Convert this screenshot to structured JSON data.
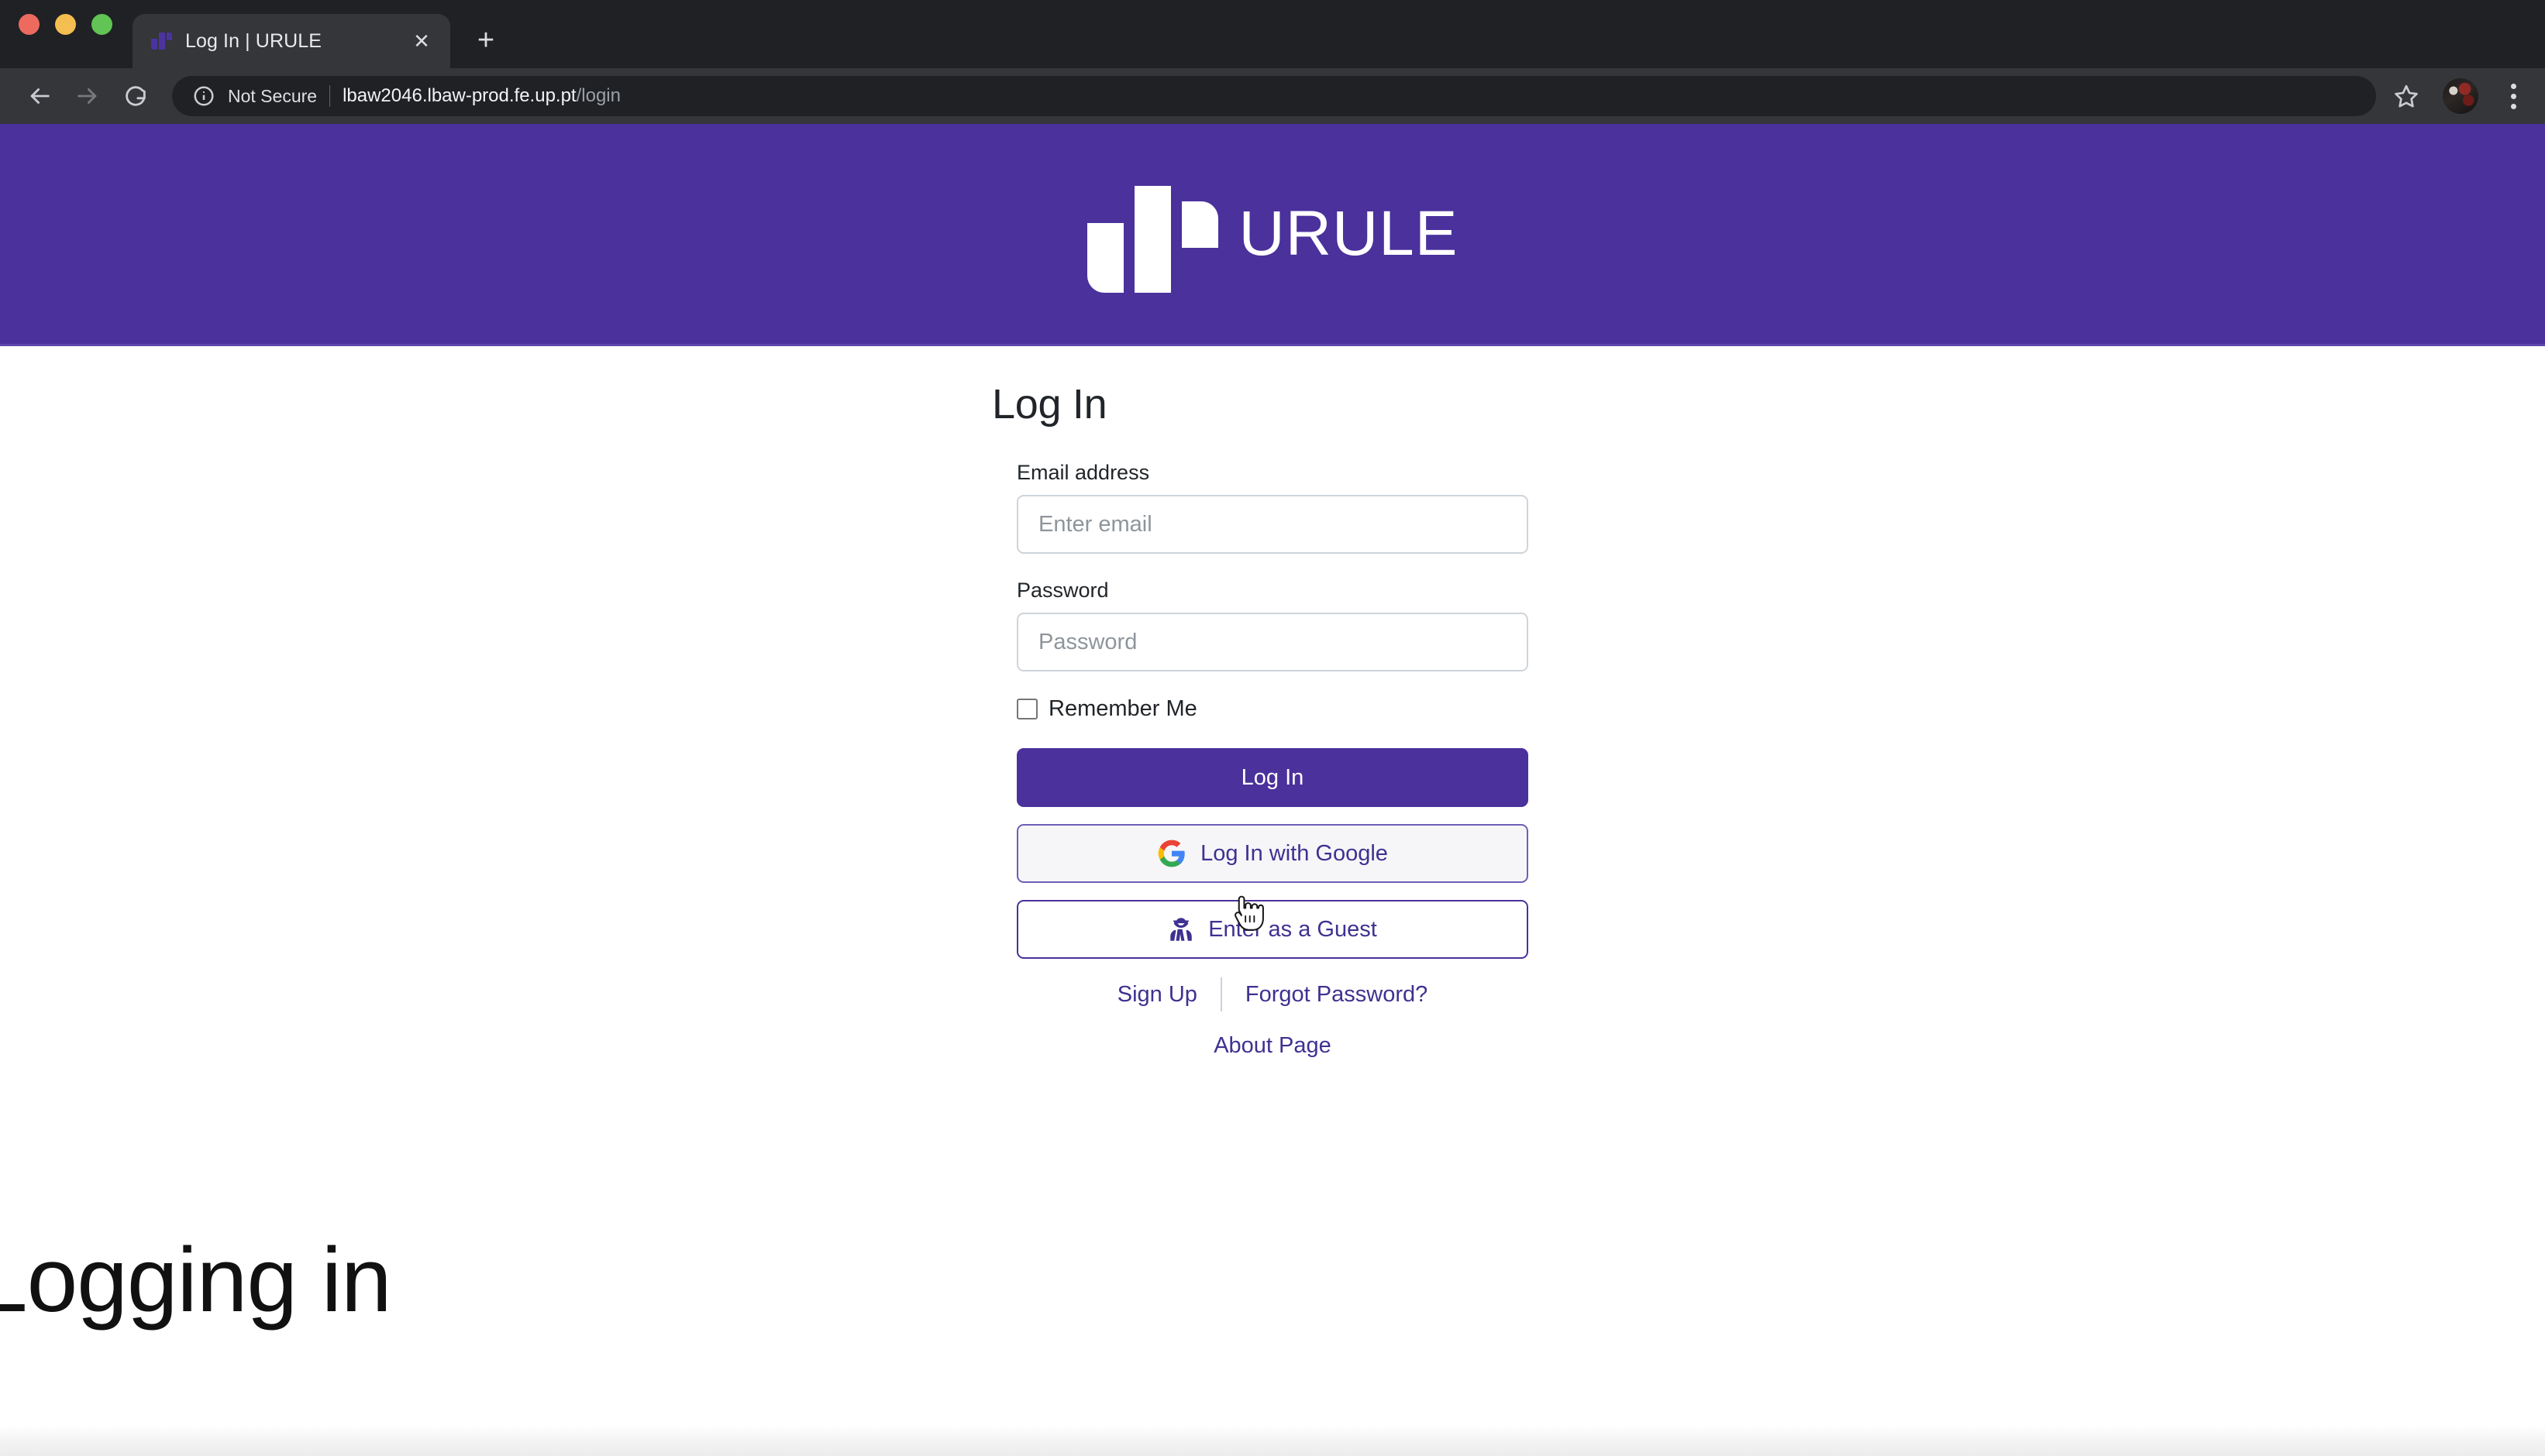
{
  "browser": {
    "tab": {
      "title": "Log In | URULE",
      "favicon": "urule-bars-favicon",
      "close_label": "✕"
    },
    "new_tab_label": "+",
    "nav": {
      "back_icon": "back-arrow-icon",
      "forward_icon": "forward-arrow-icon",
      "reload_icon": "reload-icon"
    },
    "omnibox": {
      "security_icon": "info-circle-icon",
      "security_label": "Not Secure",
      "url_host": "lbaw2046.lbaw-prod.fe.up.pt",
      "url_path": "/login"
    },
    "bookmark_icon": "star-icon",
    "profile_icon": "avatar",
    "menu_icon": "three-dot-menu-icon"
  },
  "site": {
    "header": {
      "brand_name": "URULE",
      "logo_icon": "urule-bars-logo",
      "background_color": "#4a319c"
    }
  },
  "login": {
    "title": "Log In",
    "email": {
      "label": "Email address",
      "placeholder": "Enter email",
      "value": ""
    },
    "password": {
      "label": "Password",
      "placeholder": "Password",
      "value": ""
    },
    "remember": {
      "label": "Remember Me",
      "checked": false
    },
    "submit_label": "Log In",
    "google_label": "Log In with Google",
    "google_icon": "google-g-icon",
    "guest_label": "Enter as a Guest",
    "guest_icon": "user-secret-icon",
    "links": {
      "sign_up": "Sign Up",
      "forgot_password": "Forgot Password?",
      "about": "About Page"
    },
    "accent_color": "#4a319c",
    "link_color": "#3e3191"
  },
  "overlay": {
    "status_text": "Logging in",
    "cursor_icon": "pointer-hand-cursor"
  }
}
